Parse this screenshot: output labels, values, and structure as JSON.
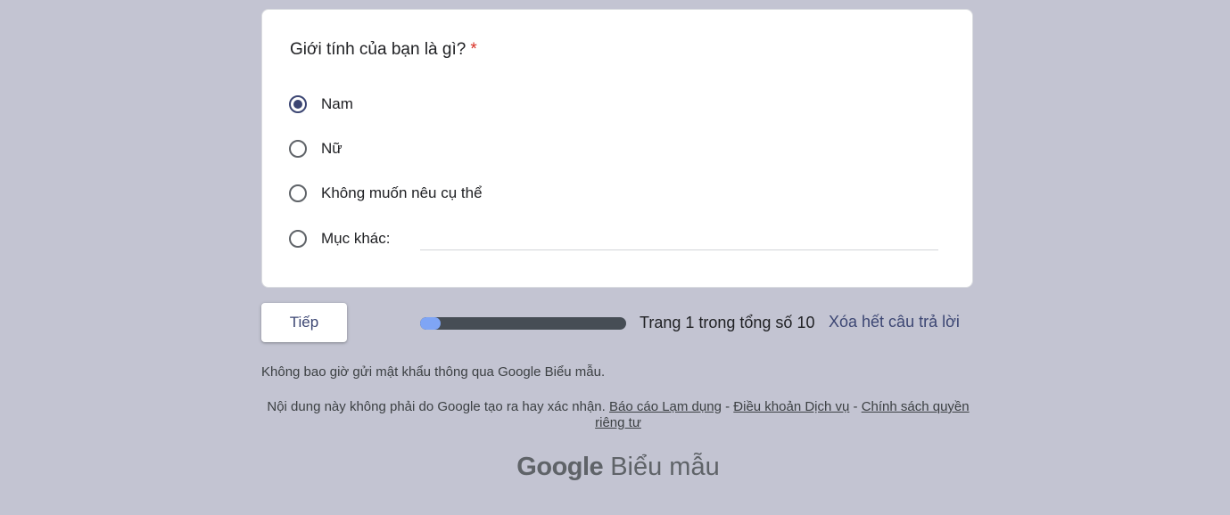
{
  "question": {
    "title": "Giới tính của bạn là gì?",
    "required_mark": "*",
    "options": [
      {
        "label": "Nam",
        "checked": true
      },
      {
        "label": "Nữ",
        "checked": false
      },
      {
        "label": "Không muốn nêu cụ thể",
        "checked": false
      },
      {
        "label": "Mục khác:",
        "checked": false
      }
    ],
    "other_value": ""
  },
  "navigation": {
    "next_label": "Tiếp",
    "progress_fraction": 0.1,
    "page_indicator": "Trang 1 trong tổng số 10",
    "clear_label": "Xóa hết câu trả lời"
  },
  "footer": {
    "password_note": "Không bao giờ gửi mật khẩu thông qua Google Biểu mẫu.",
    "disclaimer_text": "Nội dung này không phải do Google tạo ra hay xác nhận.",
    "report_link": "Báo cáo Lạm dụng",
    "terms_link": "Điều khoản Dịch vụ",
    "privacy_link": "Chính sách quyền riêng tư",
    "separator": "-",
    "logo_brand": "Google",
    "logo_product": "Biểu mẫu"
  },
  "colors": {
    "background": "#c3c4d2",
    "accent": "#3c4673",
    "required": "#d93025",
    "progress_fill": "#7fa5f5",
    "progress_track": "#464d55"
  }
}
